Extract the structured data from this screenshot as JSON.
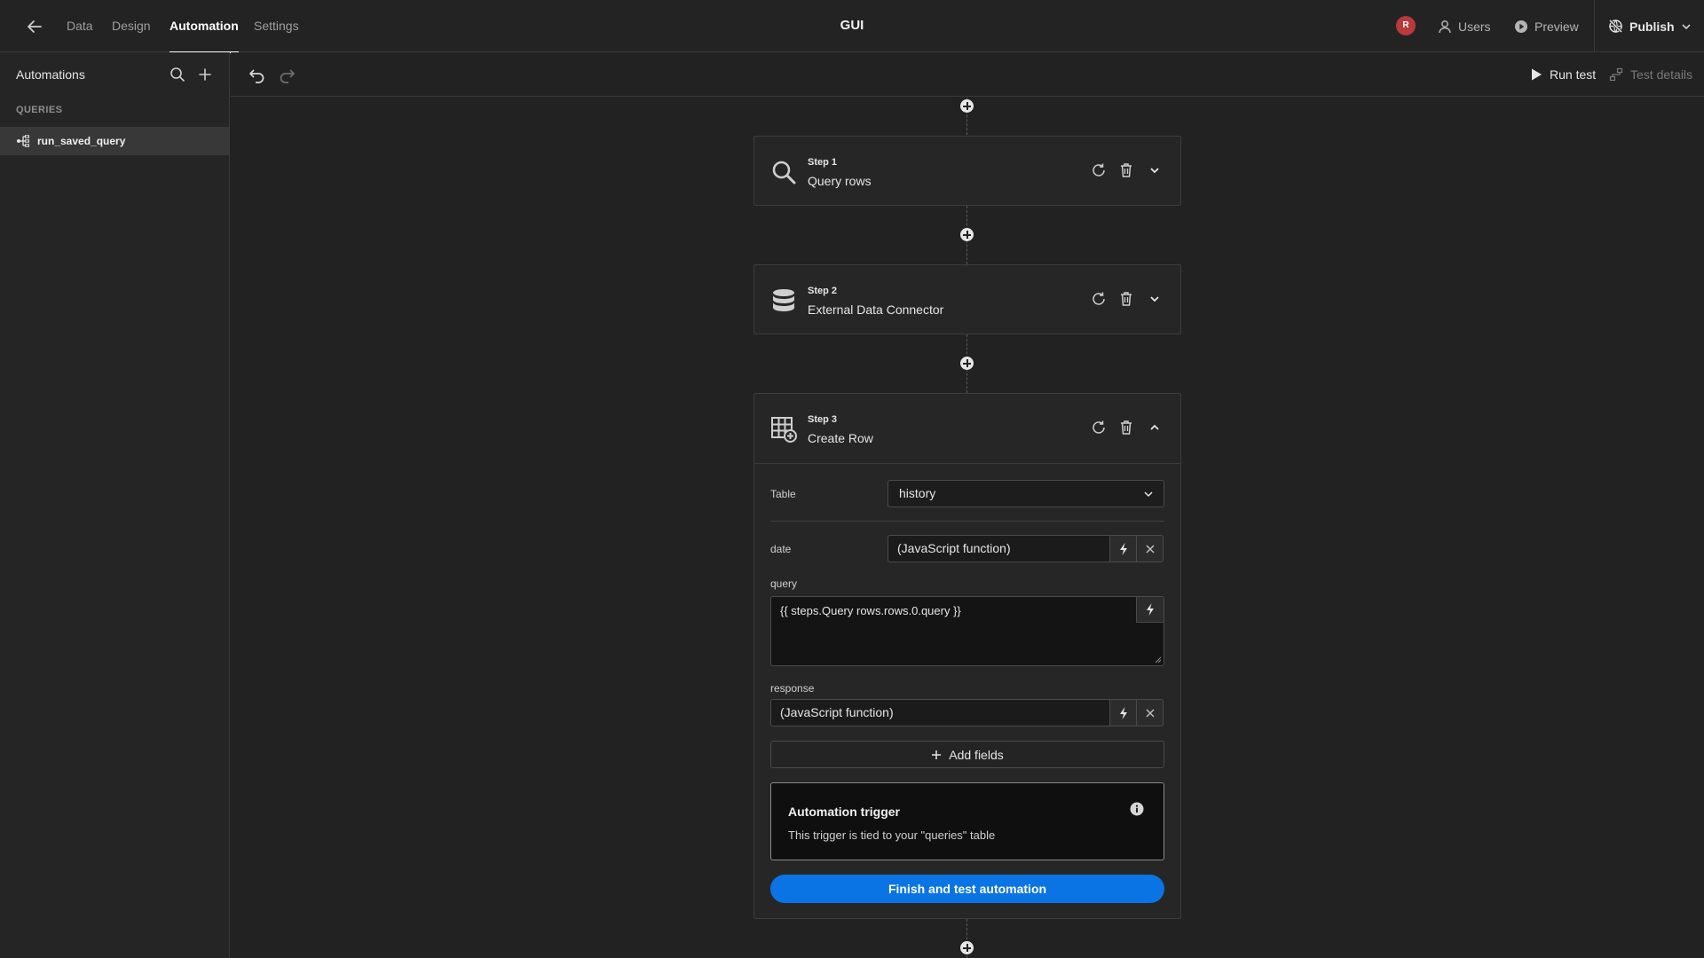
{
  "app": {
    "title": "GUI",
    "user_initial": "R"
  },
  "nav": {
    "tabs": [
      {
        "label": "Data"
      },
      {
        "label": "Design"
      },
      {
        "label": "Automation",
        "active": true
      },
      {
        "label": "Settings"
      }
    ]
  },
  "top_actions": {
    "users": "Users",
    "preview": "Preview",
    "publish": "Publish"
  },
  "sidebar": {
    "title": "Automations",
    "section": "QUERIES",
    "items": [
      {
        "label": "run_saved_query",
        "selected": true
      }
    ]
  },
  "toolbar": {
    "run_test": "Run test",
    "test_details": "Test details"
  },
  "steps": [
    {
      "number": "Step 1",
      "name": "Query rows",
      "icon": "search-icon",
      "expanded": false
    },
    {
      "number": "Step 2",
      "name": "External Data Connector",
      "icon": "database-icon",
      "expanded": false
    },
    {
      "number": "Step 3",
      "name": "Create Row",
      "icon": "table-add-icon",
      "expanded": true
    }
  ],
  "create_row": {
    "table_label": "Table",
    "table_value": "history",
    "fields": {
      "date": {
        "label": "date",
        "value": "(JavaScript function)"
      },
      "query": {
        "label": "query",
        "value": "{{ steps.Query rows.rows.0.query }}"
      },
      "response": {
        "label": "response",
        "value": "(JavaScript function)"
      }
    },
    "add_fields_label": "Add fields",
    "trigger": {
      "title": "Automation trigger",
      "description": "This trigger is tied to your \"queries\" table"
    },
    "finish_button": "Finish and test automation"
  },
  "colors": {
    "accent": "#0a74e4",
    "avatar": "#b83a3a",
    "background": "#222222"
  }
}
